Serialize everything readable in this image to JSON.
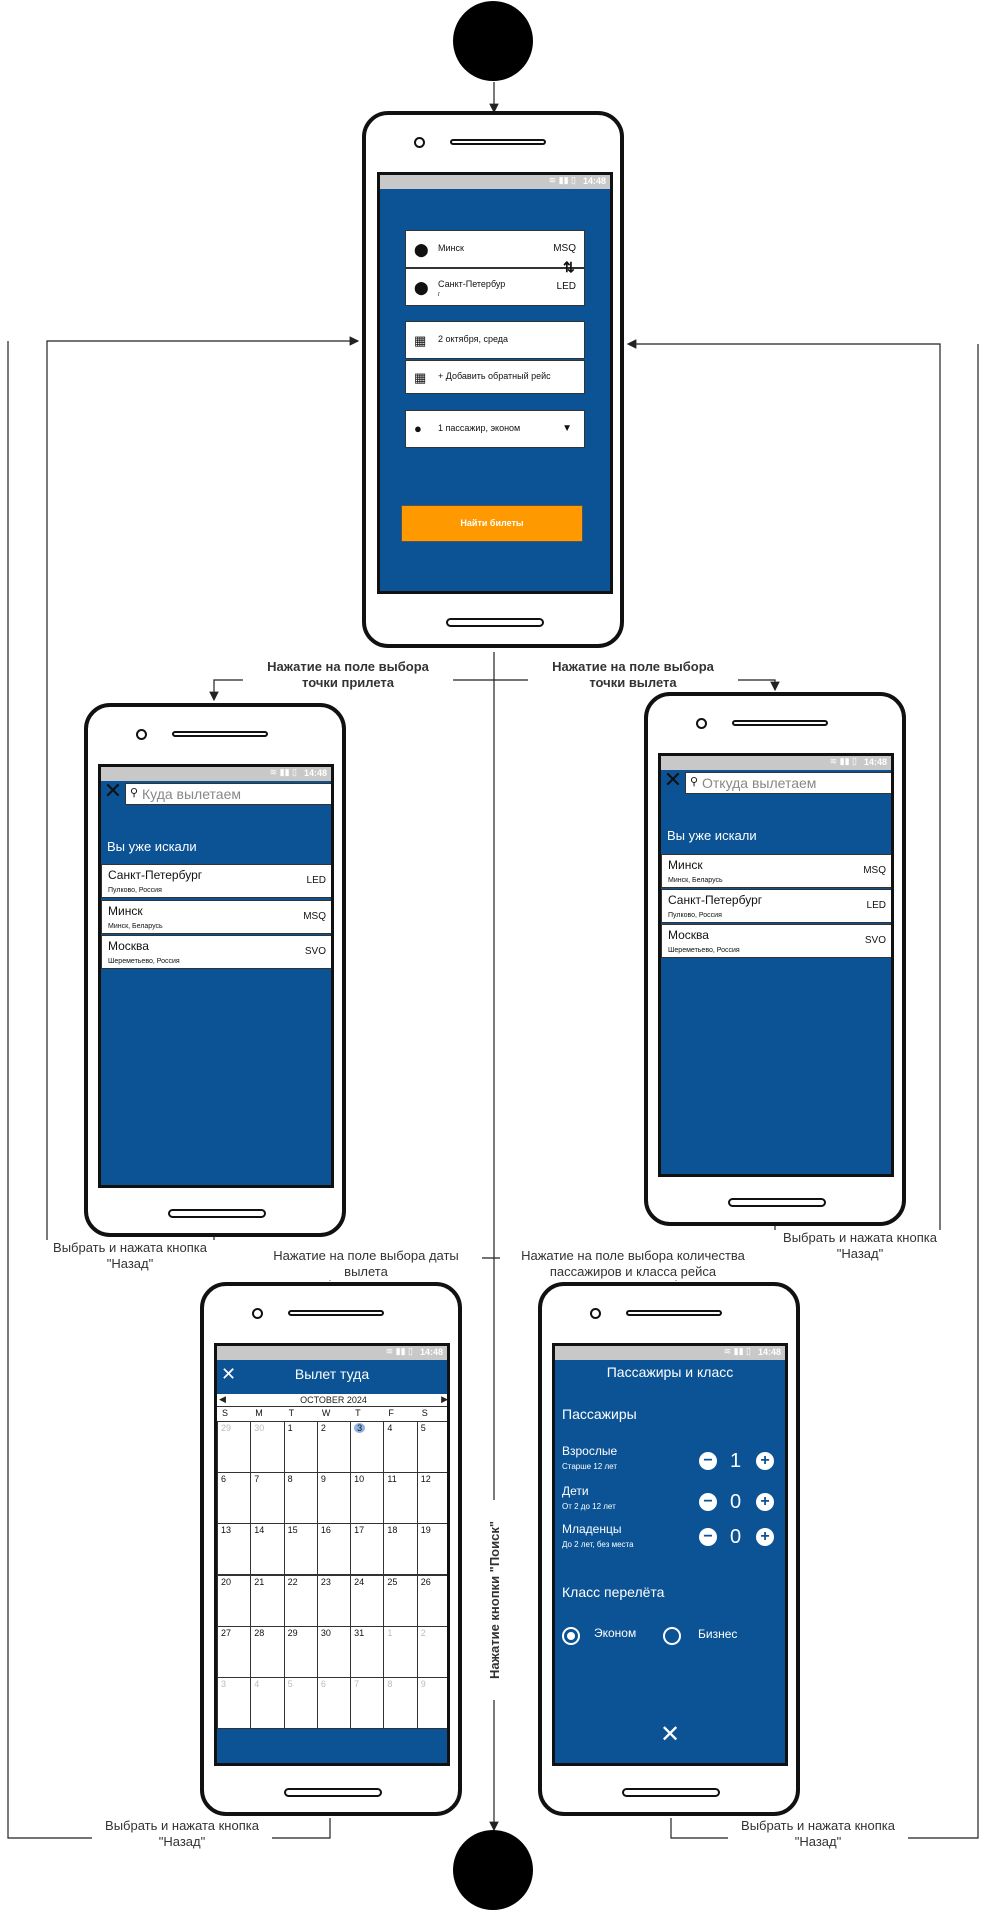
{
  "colors": {
    "brand": "#0b5394",
    "accent": "#ff9900",
    "edge": "#222222"
  },
  "status": {
    "time": "14:48"
  },
  "main_screen": {
    "from_city": "Минск",
    "from_code": "MSQ",
    "to_city": "Санкт-Петербур",
    "to_sub": "г",
    "to_code": "LED",
    "date": "2 октября, среда",
    "return": "+ Добавить обратный рейс",
    "passengers": "1 пассажир, эконом",
    "find_button": "Найти билеты"
  },
  "to_screen": {
    "search_placeholder": "Куда вылетаем",
    "section": "Вы уже искали",
    "items": [
      {
        "city": "Санкт-Петербург",
        "sub": "Пулково, Россия",
        "code": "LED"
      },
      {
        "city": "Минск",
        "sub": "Минск, Беларусь",
        "code": "MSQ"
      },
      {
        "city": "Москва",
        "sub": "Шереметьево, Россия",
        "code": "SVO"
      }
    ]
  },
  "from_screen": {
    "search_placeholder": "Откуда вылетаем",
    "section": "Вы уже искали",
    "items": [
      {
        "city": "Минск",
        "sub": "Минск, Беларусь",
        "code": "MSQ"
      },
      {
        "city": "Санкт-Петербург",
        "sub": "Пулково, Россия",
        "code": "LED"
      },
      {
        "city": "Москва",
        "sub": "Шереметьево, Россия",
        "code": "SVO"
      }
    ]
  },
  "calendar_screen": {
    "title": "Вылет туда",
    "month": "OCTOBER 2024",
    "weekdays": [
      "S",
      "M",
      "T",
      "W",
      "T",
      "F",
      "S"
    ],
    "rows": [
      [
        "29",
        "30",
        "1",
        "2",
        "3",
        "4",
        "5"
      ],
      [
        "6",
        "7",
        "8",
        "9",
        "10",
        "11",
        "12"
      ],
      [
        "13",
        "14",
        "15",
        "16",
        "17",
        "18",
        "19"
      ],
      [
        "20",
        "21",
        "22",
        "23",
        "24",
        "25",
        "26"
      ],
      [
        "27",
        "28",
        "29",
        "30",
        "31",
        "1",
        "2"
      ],
      [
        "3",
        "4",
        "5",
        "6",
        "7",
        "8",
        "9"
      ]
    ]
  },
  "pax_screen": {
    "title": "Пассажиры и класс",
    "pax_header": "Пассажиры",
    "rows": [
      {
        "label": "Взрослые",
        "sub": "Старше 12 лет",
        "count": "1"
      },
      {
        "label": "Дети",
        "sub": "От 2 до 12 лет",
        "count": "0"
      },
      {
        "label": "Младенцы",
        "sub": "До 2 лет, без места",
        "count": "0"
      }
    ],
    "class_header": "Класс перелёта",
    "class_options": [
      "Эконом",
      "Бизнес"
    ],
    "selected_class": "Эконом"
  },
  "edges": {
    "to_point": "Нажатие на поле выбора\nточки прилета",
    "from_point": "Нажатие на поле выбора\nточки вылета",
    "date": "Нажатие на поле выбора даты\nвылета",
    "pax": "Нажатие на поле выбора количества\nпассажиров и класса рейса",
    "search": "Нажатие кнопки \"Поиск\"",
    "back_left": "Выбрать и нажата кнопка\n\"Назад\"",
    "back_right": "Выбрать и нажата кнопка\n\"Назад\"",
    "back_cal": "Выбрать и нажата кнопка\n\"Назад\"",
    "back_pax": "Выбрать и нажата кнопка\n\"Назад\""
  }
}
